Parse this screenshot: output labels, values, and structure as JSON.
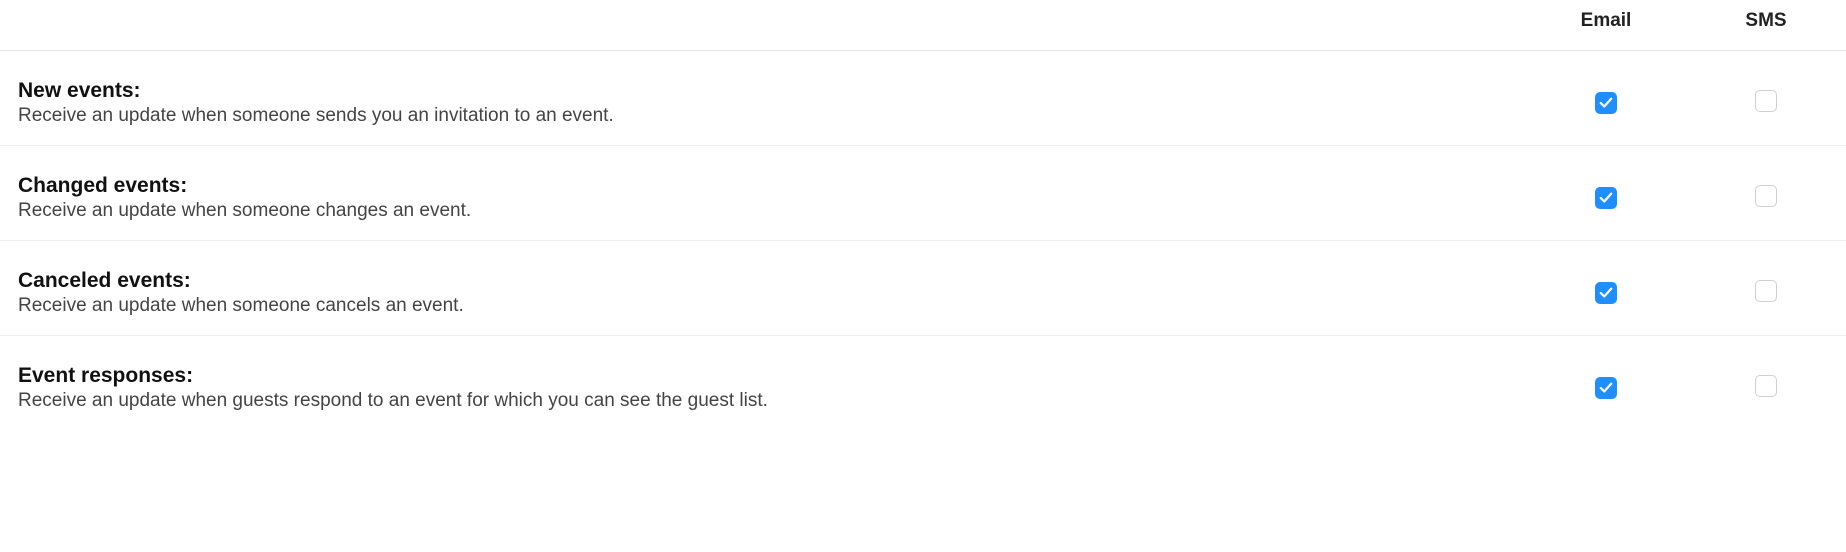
{
  "columns": {
    "email": "Email",
    "sms": "SMS"
  },
  "rows": [
    {
      "title": "New events:",
      "desc": "Receive an update when someone sends you an invitation to an event.",
      "email_checked": true,
      "sms_checked": false
    },
    {
      "title": "Changed events:",
      "desc": "Receive an update when someone changes an event.",
      "email_checked": true,
      "sms_checked": false
    },
    {
      "title": "Canceled events:",
      "desc": "Receive an update when someone cancels an event.",
      "email_checked": true,
      "sms_checked": false
    },
    {
      "title": "Event responses:",
      "desc": "Receive an update when guests respond to an event for which you can see the guest list.",
      "email_checked": true,
      "sms_checked": false
    }
  ]
}
